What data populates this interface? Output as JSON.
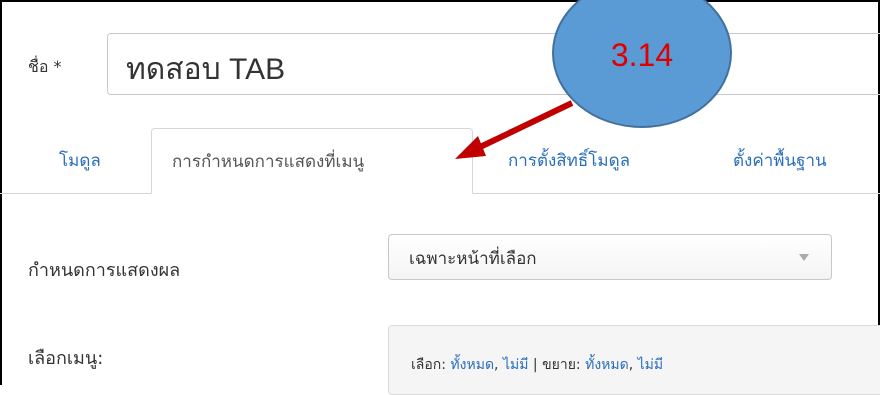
{
  "form": {
    "name_label": "ชื่อ *",
    "name_value": "ทดสอบ TAB"
  },
  "tabs": [
    {
      "label": "โมดูล",
      "active": false
    },
    {
      "label": "การกำหนดการแสดงที่เมนู",
      "active": true
    },
    {
      "label": "การตั้งสิทธิ์โมดูล",
      "active": false
    },
    {
      "label": "ตั้งค่าพื้นฐาน",
      "active": false
    }
  ],
  "display": {
    "label": "กำหนดการแสดงผล",
    "selected": "เฉพาะหน้าที่เลือก"
  },
  "menu": {
    "label": "เลือกเมนู:",
    "select_prefix": "เลือก:",
    "select_all": "ทั้งหมด",
    "select_none": "ไม่มี",
    "separator": "|",
    "expand_prefix": "ขยาย:",
    "expand_all": "ทั้งหมด",
    "expand_none": "ไม่มี"
  },
  "annotation": {
    "step": "3.14",
    "badge_color": "#5b9bd5",
    "text_color": "#e00000",
    "arrow_color": "#c00000"
  }
}
